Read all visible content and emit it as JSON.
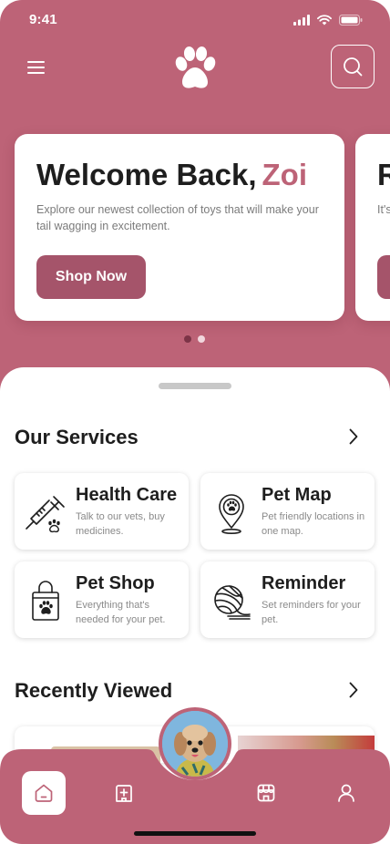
{
  "status_bar": {
    "time": "9:41"
  },
  "header": {
    "menu_icon": "hamburger-menu-icon",
    "logo_icon": "paw-logo-icon",
    "search_icon": "search-icon"
  },
  "carousel": {
    "cards": [
      {
        "title": "Welcome Back,",
        "name": "Zoi",
        "text": "Explore our newest collection of toys that will make your tail wagging in excitement.",
        "button": "Shop Now"
      },
      {
        "title": "R",
        "text": "It's su",
        "button": ""
      }
    ],
    "active_index": 0,
    "count": 2
  },
  "services": {
    "title": "Our Services",
    "items": [
      {
        "title": "Health Care",
        "desc": "Talk to our vets, buy medicines.",
        "icon": "syringe-icon"
      },
      {
        "title": "Pet Map",
        "desc": "Pet friendly locations in one map.",
        "icon": "map-pin-paw-icon"
      },
      {
        "title": "Pet Shop",
        "desc": "Everything that's needed for your pet.",
        "icon": "shopping-bag-paw-icon"
      },
      {
        "title": "Reminder",
        "desc": "Set reminders for your pet.",
        "icon": "yarn-ball-icon"
      }
    ]
  },
  "recent": {
    "title": "Recently Viewed"
  },
  "bottom_nav": {
    "items": [
      {
        "name": "home",
        "icon": "home-icon",
        "active": true
      },
      {
        "name": "health",
        "icon": "medical-cross-icon",
        "active": false
      },
      {
        "name": "profile-photo",
        "icon": "dog-avatar",
        "active": false
      },
      {
        "name": "shop",
        "icon": "store-icon",
        "active": false
      },
      {
        "name": "account",
        "icon": "user-icon",
        "active": false
      }
    ]
  },
  "colors": {
    "brand": "#bd6377",
    "button": "#a5546a",
    "dot_active": "#7c3447",
    "dot_inactive": "#f1d7dd"
  }
}
